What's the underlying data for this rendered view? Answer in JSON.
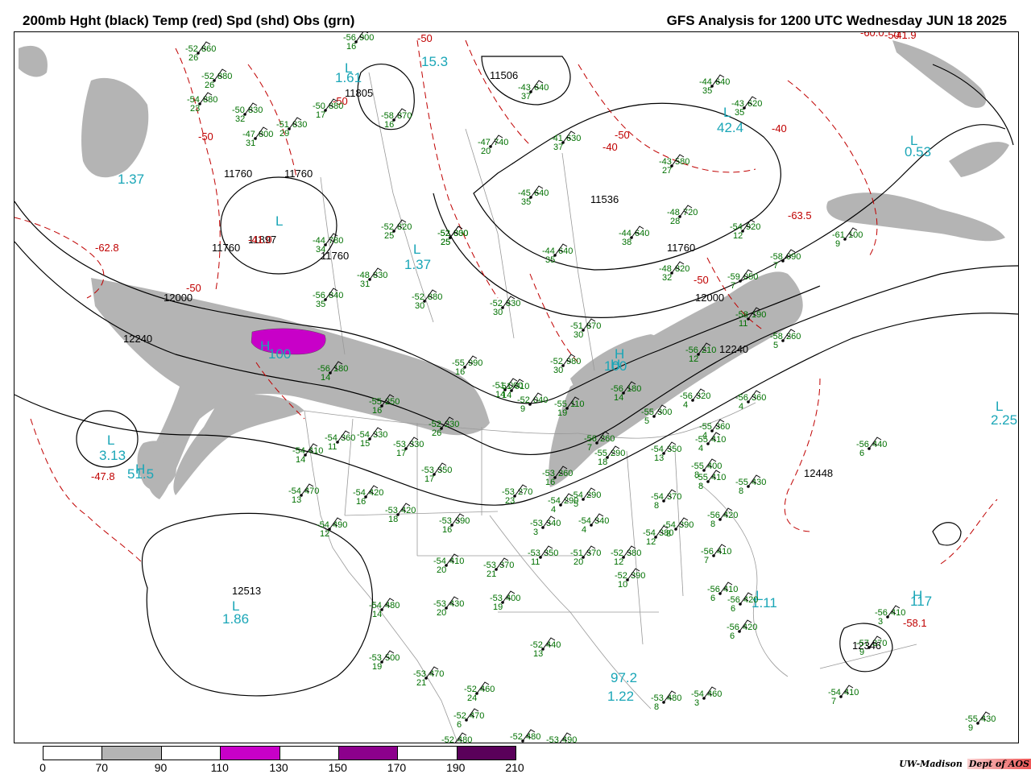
{
  "header": {
    "left_title": "200mb Hght (black) Temp (red) Spd (shd) Obs (grn)",
    "right_title": "GFS Analysis for 1200 UTC Wednesday  JUN 18 2025"
  },
  "legend": {
    "ticks": [
      "0",
      "70",
      "90",
      "110",
      "130",
      "150",
      "170",
      "190",
      "210"
    ],
    "colors": [
      "#ffffff",
      "#b4b4b4",
      "#ffffff",
      "#c800c8",
      "#ffffff",
      "#8c008c",
      "#ffffff",
      "#5a005a"
    ]
  },
  "credit": {
    "org": "UW-Madison",
    "dept": "Dept of AOS"
  },
  "height_labels": [
    "11760",
    "11760",
    "11760",
    "11760",
    "11760",
    "12000",
    "12000",
    "12240",
    "12240",
    "12448",
    "12513",
    "12346",
    "11536",
    "11506",
    "11805",
    "11897"
  ],
  "speed_labels": [
    "L",
    "L",
    "L",
    "L",
    "L",
    "L",
    "L",
    "L",
    "L",
    "H",
    "H",
    "H",
    "H",
    "H",
    "97.2",
    "1.37",
    "1.37",
    "1.61",
    "42.4",
    "15.3",
    "0.53",
    "2.25",
    "3.13",
    "1.86",
    "1.11",
    "117",
    "100",
    "100",
    "51.5",
    "1.22"
  ],
  "temp_labels": [
    "-50",
    "-50",
    "-50",
    "-50",
    "-50",
    "-50",
    "-40",
    "-40",
    "-41.0",
    "-41.9",
    "-47.8",
    "-58.1",
    "-63.5",
    "-60.0",
    "-62.8",
    "-50"
  ],
  "obs": [
    {
      "t": "-52",
      "h": "860",
      "s": "26"
    },
    {
      "t": "-52",
      "h": "880",
      "s": "26"
    },
    {
      "t": "-54",
      "h": "880",
      "s": "23"
    },
    {
      "t": "-50",
      "h": "830",
      "s": "32"
    },
    {
      "t": "-47",
      "h": "800",
      "s": "31"
    },
    {
      "t": "-51",
      "h": "830",
      "s": "29"
    },
    {
      "t": "-50",
      "h": "880",
      "s": "17"
    },
    {
      "t": "-56",
      "h": "900",
      "s": "16"
    },
    {
      "t": "-58",
      "h": "870",
      "s": "16"
    },
    {
      "t": "-47",
      "h": "740",
      "s": "20"
    },
    {
      "t": "-41",
      "h": "630",
      "s": "37"
    },
    {
      "t": "-43",
      "h": "640",
      "s": "37"
    },
    {
      "t": "-44",
      "h": "640",
      "s": "35"
    },
    {
      "t": "-43",
      "h": "620",
      "s": "35"
    },
    {
      "t": "-43",
      "h": "580",
      "s": "27"
    },
    {
      "t": "-45",
      "h": "640",
      "s": "35"
    },
    {
      "t": "-48",
      "h": "720",
      "s": "28"
    },
    {
      "t": "-54",
      "h": "920",
      "s": "12"
    },
    {
      "t": "-61",
      "h": "100",
      "s": "9"
    },
    {
      "t": "-52",
      "h": "820",
      "s": "25"
    },
    {
      "t": "-52",
      "h": "830",
      "s": "25"
    },
    {
      "t": "-52",
      "h": "800",
      "s": "25"
    },
    {
      "t": "-44",
      "h": "780",
      "s": "34"
    },
    {
      "t": "-48",
      "h": "830",
      "s": "31"
    },
    {
      "t": "-44",
      "h": "640",
      "s": "35"
    },
    {
      "t": "-44",
      "h": "640",
      "s": "38"
    },
    {
      "t": "-58",
      "h": "090",
      "s": "7"
    },
    {
      "t": "-48",
      "h": "820",
      "s": "32"
    },
    {
      "t": "-59",
      "h": "050",
      "s": "7"
    },
    {
      "t": "-56",
      "h": "840",
      "s": "35"
    },
    {
      "t": "-52",
      "h": "880",
      "s": "30"
    },
    {
      "t": "-52",
      "h": "830",
      "s": "30"
    },
    {
      "t": "-51",
      "h": "870",
      "s": "30"
    },
    {
      "t": "-58",
      "h": "190",
      "s": "11"
    },
    {
      "t": "-58",
      "h": "260",
      "s": "5"
    },
    {
      "t": "-56",
      "h": "210",
      "s": "12"
    },
    {
      "t": "-52",
      "h": "980",
      "s": "30"
    },
    {
      "t": "-51",
      "h": "000",
      "s": "14"
    },
    {
      "t": "-56",
      "h": "180",
      "s": "14"
    },
    {
      "t": "-55",
      "h": "990",
      "s": "16"
    },
    {
      "t": "-51",
      "h": "010",
      "s": "14"
    },
    {
      "t": "-52",
      "h": "040",
      "s": "9"
    },
    {
      "t": "-56",
      "h": "180",
      "s": "14"
    },
    {
      "t": "-55",
      "h": "110",
      "s": "19"
    },
    {
      "t": "-56",
      "h": "320",
      "s": "4"
    },
    {
      "t": "-56",
      "h": "360",
      "s": "4"
    },
    {
      "t": "-55",
      "h": "300",
      "s": "5"
    },
    {
      "t": "-55",
      "h": "250",
      "s": "16"
    },
    {
      "t": "-52",
      "h": "230",
      "s": "26"
    },
    {
      "t": "-56",
      "h": "260",
      "s": "7"
    },
    {
      "t": "-54",
      "h": "360",
      "s": "11"
    },
    {
      "t": "-54",
      "h": "330",
      "s": "15"
    },
    {
      "t": "-53",
      "h": "330",
      "s": "17"
    },
    {
      "t": "-54",
      "h": "410",
      "s": "14"
    },
    {
      "t": "-55",
      "h": "290",
      "s": "18"
    },
    {
      "t": "-54",
      "h": "350",
      "s": "13"
    },
    {
      "t": "-55",
      "h": "360",
      "s": "4"
    },
    {
      "t": "-55",
      "h": "410",
      "s": "4"
    },
    {
      "t": "-53",
      "h": "350",
      "s": "17"
    },
    {
      "t": "-53",
      "h": "260",
      "s": "16"
    },
    {
      "t": "-53",
      "h": "270",
      "s": "23"
    },
    {
      "t": "-54",
      "h": "470",
      "s": "13"
    },
    {
      "t": "-54",
      "h": "420",
      "s": "16"
    },
    {
      "t": "-53",
      "h": "420",
      "s": "18"
    },
    {
      "t": "-54",
      "h": "290",
      "s": "4"
    },
    {
      "t": "-54",
      "h": "290",
      "s": "5"
    },
    {
      "t": "-54",
      "h": "370",
      "s": "8"
    },
    {
      "t": "-55",
      "h": "400",
      "s": "8"
    },
    {
      "t": "-55",
      "h": "410",
      "s": "8"
    },
    {
      "t": "-55",
      "h": "430",
      "s": "8"
    },
    {
      "t": "-56",
      "h": "440",
      "s": "6"
    },
    {
      "t": "-54",
      "h": "490",
      "s": "12"
    },
    {
      "t": "-53",
      "h": "390",
      "s": "16"
    },
    {
      "t": "-53",
      "h": "340",
      "s": "3"
    },
    {
      "t": "-54",
      "h": "340",
      "s": "4"
    },
    {
      "t": "-54",
      "h": "380",
      "s": "12"
    },
    {
      "t": "-54",
      "h": "390",
      "s": "8"
    },
    {
      "t": "-56",
      "h": "420",
      "s": "8"
    },
    {
      "t": "-54",
      "h": "410",
      "s": "20"
    },
    {
      "t": "-53",
      "h": "370",
      "s": "21"
    },
    {
      "t": "-53",
      "h": "350",
      "s": "11"
    },
    {
      "t": "-51",
      "h": "370",
      "s": "20"
    },
    {
      "t": "-52",
      "h": "380",
      "s": "12"
    },
    {
      "t": "-56",
      "h": "410",
      "s": "7"
    },
    {
      "t": "-52",
      "h": "390",
      "s": "10"
    },
    {
      "t": "-56",
      "h": "420",
      "s": "6"
    },
    {
      "t": "-56",
      "h": "410",
      "s": "6"
    },
    {
      "t": "-54",
      "h": "480",
      "s": "14"
    },
    {
      "t": "-53",
      "h": "430",
      "s": "20"
    },
    {
      "t": "-53",
      "h": "400",
      "s": "19"
    },
    {
      "t": "-56",
      "h": "410",
      "s": "3"
    },
    {
      "t": "-56",
      "h": "420",
      "s": "6"
    },
    {
      "t": "-57",
      "h": "370",
      "s": "9"
    },
    {
      "t": "-52",
      "h": "440",
      "s": "13"
    },
    {
      "t": "-53",
      "h": "500",
      "s": "19"
    },
    {
      "t": "-53",
      "h": "470",
      "s": "21"
    },
    {
      "t": "-52",
      "h": "460",
      "s": "24"
    },
    {
      "t": "-53",
      "h": "480",
      "s": "8"
    },
    {
      "t": "-54",
      "h": "460",
      "s": "3"
    },
    {
      "t": "-54",
      "h": "410",
      "s": "7"
    },
    {
      "t": "-52",
      "h": "470",
      "s": "6"
    },
    {
      "t": "-55",
      "h": "430",
      "s": "9"
    },
    {
      "t": "-52",
      "h": "480",
      "s": ""
    },
    {
      "t": "-53",
      "h": "490",
      "s": ""
    },
    {
      "t": "-52",
      "h": "480",
      "s": ""
    }
  ]
}
